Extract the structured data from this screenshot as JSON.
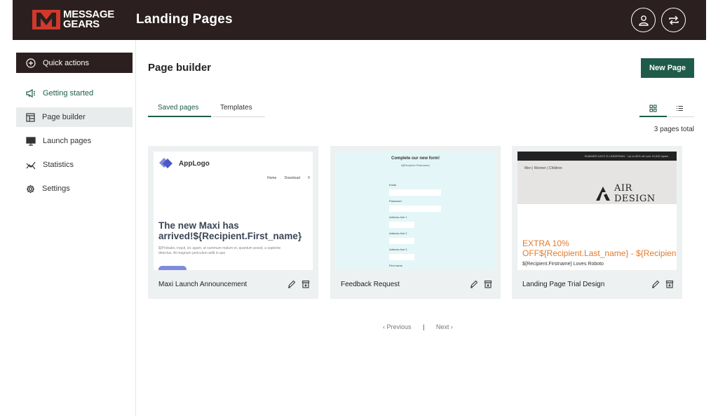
{
  "header": {
    "logo_line1": "MESSAGE",
    "logo_line2": "GEARS",
    "app_title": "Landing Pages",
    "icons": [
      "user-icon",
      "switch-icon"
    ]
  },
  "sidebar": {
    "quick_actions": "Quick actions",
    "items": [
      {
        "label": "Getting started",
        "icon": "megaphone-icon"
      },
      {
        "label": "Page builder",
        "icon": "layout-icon"
      },
      {
        "label": "Launch pages",
        "icon": "monitor-icon"
      },
      {
        "label": "Statistics",
        "icon": "chart-icon"
      },
      {
        "label": "Settings",
        "icon": "gear-icon"
      }
    ]
  },
  "main": {
    "title": "Page builder",
    "new_page": "New Page",
    "tabs": [
      {
        "label": "Saved pages"
      },
      {
        "label": "Templates"
      }
    ],
    "pages_total": "3 pages total",
    "cards": [
      {
        "name": "Maxi Launch Announcement",
        "thumb": {
          "logo": "AppLogo",
          "nav": [
            "Home",
            "Download",
            "F"
          ],
          "headline1": "The new Maxi has",
          "headline2": "arrived!${Recipient.First_name}",
          "para1": "${Probabo, inquit, sic agam, ut summum malum et, quantum possit, a sapiente",
          "para2": "delectus. At magnum periculum adiit in quo"
        }
      },
      {
        "name": "Feedback Request",
        "thumb": {
          "title": "Complete our new form!",
          "subtitle": "${Recipient.Firstname}",
          "labels": [
            "Email",
            "Password",
            "Address line 1",
            "Address line 2",
            "Address line 3",
            "First name"
          ]
        }
      },
      {
        "name": "Landing Page Trial Design",
        "thumb": {
          "topbar": "SUMMER DAYS IS UNDERWAY - Up to 50% off over 10,000 styles",
          "nav": "Men   |   Women   |   Children",
          "brand": "AIR DESIGN",
          "offer1": "EXTRA 10%",
          "offer2": "OFF${Recipient.Last_name} - ${Recipient.First_name}",
          "sub": "${Recipient.Firstname} Loves Roboto"
        }
      }
    ],
    "pager": {
      "previous": "‹ Previous",
      "separator": "|",
      "next": "Next ›"
    }
  },
  "colors": {
    "header_bg": "#2b1f1f",
    "accent_green": "#1f5b4a",
    "logo_red": "#d0392b",
    "card_bg": "#eef1f1"
  }
}
